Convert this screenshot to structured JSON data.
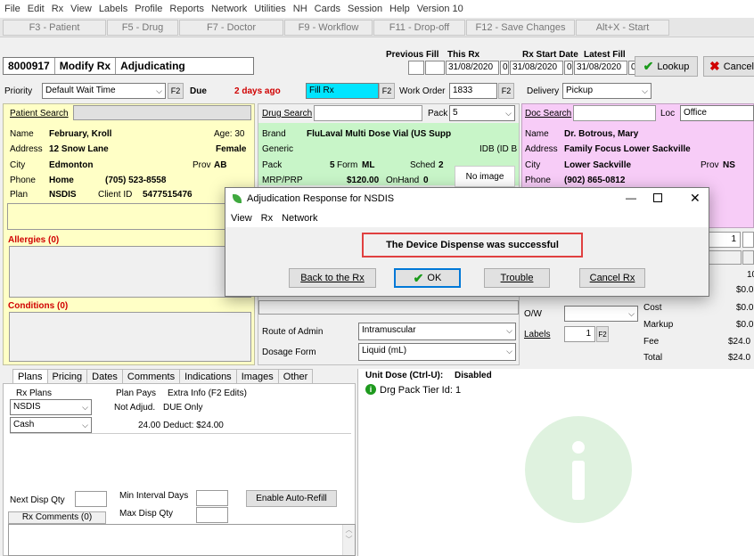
{
  "menu": [
    "File",
    "Edit",
    "Rx",
    "View",
    "Labels",
    "Profile",
    "Reports",
    "Network",
    "Utilities",
    "NH",
    "Cards",
    "Session",
    "Help",
    "Version 10"
  ],
  "fkeys": [
    "F3 - Patient",
    "F5 - Drug",
    "F7 - Doctor",
    "F9 - Workflow",
    "F11 - Drop-off",
    "F12 - Save Changes",
    "Alt+X - Start"
  ],
  "status": {
    "rx_number": "8000917",
    "mode": "Modify Rx",
    "state": "Adjudicating"
  },
  "header": {
    "previous_fill_label": "Previous Fill",
    "this_rx_label": "This Rx",
    "this_rx_date": "31/08/2020",
    "this_rx_count": "0",
    "rx_start_date_label": "Rx Start Date",
    "rx_start_date": "31/08/2020",
    "rx_start_count": "0",
    "latest_fill_label": "Latest Fill",
    "latest_fill_date": "31/08/2020",
    "latest_fill_count": "0",
    "lookup_label": "Lookup",
    "cancel_label": "Cancel"
  },
  "priority_row": {
    "priority_label": "Priority",
    "priority_value": "Default Wait Time",
    "f2": "F2",
    "due_label": "Due",
    "due_value": "2 days ago",
    "fill_value": "Fill Rx",
    "work_order_label": "Work Order",
    "work_order_value": "1833",
    "delivery_label": "Delivery",
    "delivery_value": "Pickup"
  },
  "patient": {
    "search_label": "Patient Search",
    "name_label": "Name",
    "name": "February, Kroll",
    "age": "Age: 30",
    "address_label": "Address",
    "address": "12 Snow Lane",
    "gender": "Female",
    "city_label": "City",
    "city": "Edmonton",
    "prov_label": "Prov",
    "prov": "AB",
    "phone_label": "Phone",
    "phone_type": "Home",
    "phone": "(705) 523-8558",
    "plan_label": "Plan",
    "plan": "NSDIS",
    "client_id_label": "Client ID",
    "client_id": "5477515476",
    "allergies": "Allergies (0)",
    "conditions": "Conditions (0)"
  },
  "drug": {
    "search_label": "Drug Search",
    "pack_label": "Pack",
    "pack_value": "5",
    "brand_label": "Brand",
    "brand": "FluLaval Multi Dose Vial (US Supp",
    "generic_label": "Generic",
    "idb": "IDB (ID B",
    "pack2_label": "Pack",
    "pack2_value": "5",
    "form_label": "Form",
    "form_value": "ML",
    "sched_label": "Sched",
    "sched_value": "2",
    "mrp_label": "MRP/PRP",
    "mrp_value": "$120.00",
    "onhand_label": "OnHand",
    "onhand_value": "0",
    "no_image": "No image",
    "route_label": "Route of Admin",
    "route_value": "Intramuscular",
    "dosage_label": "Dosage Form",
    "dosage_value": "Liquid (mL)"
  },
  "doctor": {
    "search_label": "Doc Search",
    "loc_label": "Loc",
    "loc_value": "Office",
    "name_label": "Name",
    "name": "Dr. Botrous, Mary",
    "address_label": "Address",
    "address": "Family Focus Lower Sackville",
    "city_label": "City",
    "city": "Lower Sackville",
    "prov_label": "Prov",
    "prov": "NS",
    "phone_label": "Phone",
    "phone": "(902) 865-0812"
  },
  "pricing": {
    "qty_value": "1",
    "value_10": "10",
    "value_a": "$0.0",
    "ow_label": "O/W",
    "cost_label": "Cost",
    "cost_value": "$0.0",
    "labels_label": "Labels",
    "labels_value": "1",
    "f2": "F2",
    "markup_label": "Markup",
    "markup_value": "$0.0",
    "fee_label": "Fee",
    "fee_value": "$24.0",
    "total_label": "Total",
    "total_value": "$24.0"
  },
  "bottom_tabs": [
    "Plans",
    "Pricing",
    "Dates",
    "Comments",
    "Indications",
    "Images",
    "Other"
  ],
  "plans_table": {
    "headers": [
      "Rx Plans",
      "Plan Pays",
      "Extra Info (F2 Edits)"
    ],
    "rows": [
      {
        "plan": "NSDIS",
        "pays": "Not Adjud.",
        "info": "DUE Only"
      },
      {
        "plan": "Cash",
        "pays": "24.00",
        "info": "Deduct: $24.00"
      }
    ]
  },
  "refill": {
    "next_disp_label": "Next Disp Qty",
    "min_interval_label": "Min Interval Days",
    "max_disp_label": "Max Disp Qty",
    "auto_refill_label": "Enable Auto-Refill",
    "rx_comments_label": "Rx Comments (0)"
  },
  "unit_dose": {
    "label": "Unit Dose (Ctrl-U):",
    "state": "Disabled",
    "tier_text": "Drg Pack Tier Id: 1"
  },
  "dialog": {
    "title": "Adjudication Response for NSDIS",
    "menu": [
      "View",
      "Rx",
      "Network"
    ],
    "message": "The Device Dispense was successful",
    "back_label": "Back to the Rx",
    "ok_label": "OK",
    "trouble_label": "Trouble",
    "cancel_rx_label": "Cancel Rx"
  },
  "colors": {
    "patient": "#ffffc6",
    "drug": "#c8f5c8",
    "doctor": "#f7ccf7",
    "accent": "#d00000",
    "fill_rx": "#00e5ff"
  }
}
